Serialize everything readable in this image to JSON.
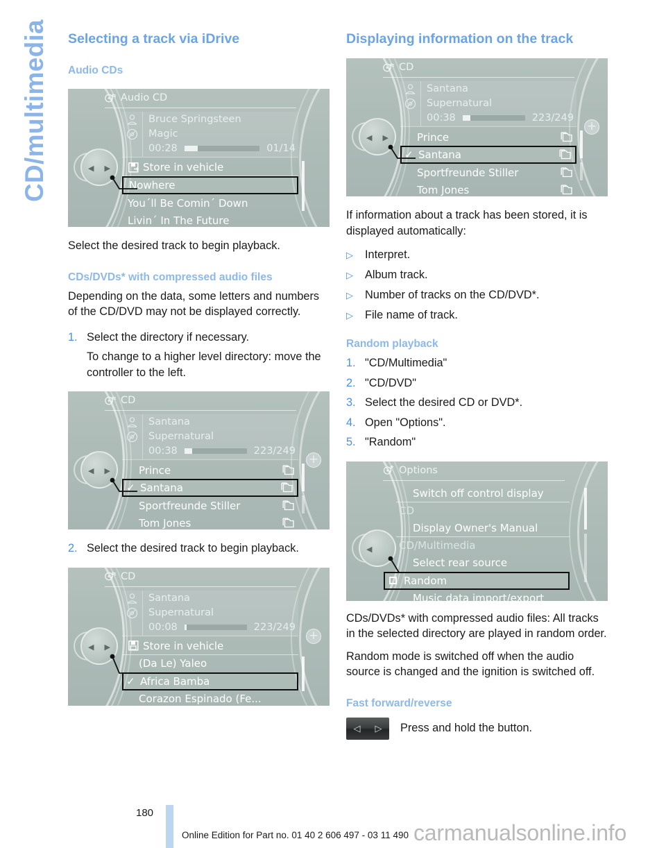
{
  "side_tab": {
    "label": "CD/multimedia"
  },
  "left_column": {
    "heading": "Selecting a track via iDrive",
    "sub_heading_1": "Audio CDs",
    "screen_audio_cd": {
      "title": "Audio CD",
      "title_icon": "cd-note-icon",
      "artist": "Bruce Springsteen",
      "album": "Magic",
      "elapsed": "00:28",
      "track_count": "01/14",
      "progress_percent": 18,
      "artist_icon": "person-icon",
      "album_icon": "disc-icon",
      "rows": [
        {
          "label": "Store in vehicle",
          "icon": "save-disk-icon",
          "highlight": false,
          "separator": true
        },
        {
          "label": "Nowhere",
          "icon": "",
          "highlight": true,
          "separator": false
        },
        {
          "label": "You´ll Be Comin´ Down",
          "icon": "",
          "highlight": false,
          "separator": false
        },
        {
          "label": "Livin´ In The Future",
          "icon": "",
          "highlight": false,
          "separator": false
        }
      ]
    },
    "para_1": "Select the desired track to begin playback.",
    "sub_heading_2": "CDs/DVDs* with compressed audio files",
    "para_2": "Depending on the data, some letters and numbers of the CD/DVD may not be displayed correctly.",
    "steps": [
      {
        "num": "1.",
        "text": "Select the directory if necessary.",
        "sub": "To change to a higher level directory: move the controller to the left."
      }
    ],
    "screen_cd_dirs": {
      "title": "CD",
      "title_icon": "cd-note-icon",
      "artist": "Santana",
      "album": "Supernatural",
      "elapsed": "00:38",
      "track_count": "223/249",
      "progress_percent": 12,
      "rows": [
        {
          "label": "Prince",
          "icon": "folder-icon",
          "check": false,
          "highlight": false
        },
        {
          "label": "Santana",
          "icon": "folder-icon",
          "check": true,
          "highlight": true
        },
        {
          "label": "Sportfreunde Stiller",
          "icon": "folder-icon",
          "check": false,
          "highlight": false
        },
        {
          "label": "Tom Jones",
          "icon": "folder-icon",
          "check": false,
          "highlight": false
        }
      ]
    },
    "step_2": {
      "num": "2.",
      "text": "Select the desired track to begin playback."
    },
    "screen_cd_tracks": {
      "title": "CD",
      "title_icon": "cd-note-icon",
      "artist": "Santana",
      "album": "Supernatural",
      "elapsed": "00:08",
      "track_count": "223/249",
      "progress_percent": 4,
      "rows": [
        {
          "label": "Store in vehicle",
          "icon": "save-disk-icon",
          "check": false,
          "highlight": false,
          "separator": true
        },
        {
          "label": "(Da Le) Yaleo",
          "icon": "",
          "check": false,
          "highlight": false,
          "separator": false
        },
        {
          "label": "Africa Bamba",
          "icon": "",
          "check": true,
          "highlight": true,
          "separator": false
        },
        {
          "label": "Corazon Espinado (Fe...",
          "icon": "",
          "check": false,
          "highlight": false,
          "separator": false
        }
      ]
    }
  },
  "right_column": {
    "heading": "Displaying information on the track",
    "screen_track_info": {
      "title": "CD",
      "title_icon": "cd-note-icon",
      "artist": "Santana",
      "album": "Supernatural",
      "elapsed": "00:38",
      "track_count": "223/249",
      "progress_percent": 12,
      "rows": [
        {
          "label": "Prince",
          "icon": "folder-icon",
          "check": false,
          "highlight": false
        },
        {
          "label": "Santana",
          "icon": "folder-icon",
          "check": true,
          "highlight": true
        },
        {
          "label": "Sportfreunde Stiller",
          "icon": "folder-icon",
          "check": false,
          "highlight": false
        },
        {
          "label": "Tom Jones",
          "icon": "folder-icon",
          "check": false,
          "highlight": false
        }
      ]
    },
    "para_1": "If information about a track has been stored, it is displayed automatically:",
    "bullets": [
      "Interpret.",
      "Album track.",
      "Number of tracks on the CD/DVD*.",
      "File name of track."
    ],
    "sub_heading_random": "Random playback",
    "random_steps": [
      {
        "num": "1.",
        "text": "\"CD/Multimedia\""
      },
      {
        "num": "2.",
        "text": "\"CD/DVD\""
      },
      {
        "num": "3.",
        "text": "Select the desired CD or DVD*."
      },
      {
        "num": "4.",
        "text": "Open \"Options\"."
      },
      {
        "num": "5.",
        "text": "\"Random\""
      }
    ],
    "screen_options": {
      "title": "Options",
      "title_icon": "options-icon",
      "rows": [
        {
          "label": "Switch off control display",
          "type": "item",
          "highlight": false
        },
        {
          "label": "CD",
          "type": "group",
          "highlight": false
        },
        {
          "label": "Display Owner's Manual",
          "type": "item",
          "highlight": false
        },
        {
          "label": "CD/Multimedia",
          "type": "group",
          "highlight": false
        },
        {
          "label": "Select rear source",
          "type": "item",
          "highlight": false
        },
        {
          "label": "Random",
          "type": "checkbox",
          "highlight": true
        },
        {
          "label": "Music data import/export",
          "type": "item",
          "highlight": false
        }
      ]
    },
    "para_random_1": "CDs/DVDs* with compressed audio files: All tracks in the selected directory are played in random order.",
    "para_random_2": "Random mode is switched off when the audio source is changed and the ignition is switched off.",
    "sub_heading_ff": "Fast forward/reverse",
    "ff_button": {
      "left_glyph": "◁",
      "right_glyph": "▷",
      "name": "fast-forward-reverse-button"
    },
    "ff_text": "Press and hold the button."
  },
  "footer": {
    "page_number": "180",
    "text": "Online Edition for Part no. 01 40 2 606 497 - 03 11 490",
    "watermark": "carmanualsonline.info"
  },
  "colors": {
    "accent_blue": "#6ba4e4",
    "light_blue": "#8cb9ea",
    "idrive_bg": "#aebcb8",
    "footer_bar": "#bcd6f2"
  }
}
